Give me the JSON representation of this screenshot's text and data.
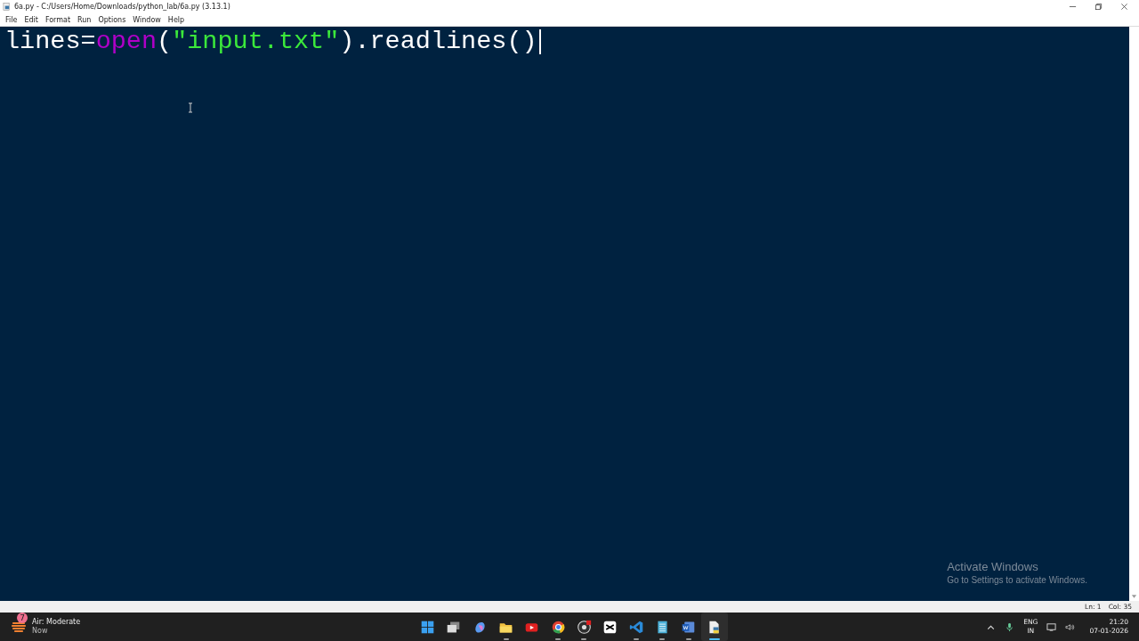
{
  "window": {
    "title": "6a.py - C:/Users/Home/Downloads/python_lab/6a.py (3.13.1)"
  },
  "menu": [
    {
      "label": "File"
    },
    {
      "label": "Edit"
    },
    {
      "label": "Format"
    },
    {
      "label": "Run"
    },
    {
      "label": "Options"
    },
    {
      "label": "Window"
    },
    {
      "label": "Help"
    }
  ],
  "editor": {
    "lines": [
      [
        {
          "text": "lines=",
          "kind": "plain"
        },
        {
          "text": "open",
          "kind": "builtin"
        },
        {
          "text": "(",
          "kind": "plain"
        },
        {
          "text": "\"input.txt\"",
          "kind": "string"
        },
        {
          "text": ").readlines()",
          "kind": "plain"
        }
      ]
    ]
  },
  "watermark": {
    "title": "Activate Windows",
    "subtitle": "Go to Settings to activate Windows."
  },
  "status_bar": {
    "line": "Ln: 1",
    "column": "Col: 35"
  },
  "taskbar": {
    "widget": {
      "badge": "7",
      "title": "Air: Moderate",
      "subtitle": "Now"
    },
    "apps": [
      {
        "kind": "start",
        "running": false,
        "selected": false
      },
      {
        "kind": "taskview",
        "running": false,
        "selected": false
      },
      {
        "kind": "copilot",
        "running": false,
        "selected": false
      },
      {
        "kind": "folder",
        "running": true,
        "selected": false
      },
      {
        "kind": "youtube",
        "running": false,
        "selected": false
      },
      {
        "kind": "chrome",
        "running": true,
        "selected": false
      },
      {
        "kind": "obs",
        "running": true,
        "selected": false
      },
      {
        "kind": "capcut",
        "running": false,
        "selected": false
      },
      {
        "kind": "vscode",
        "running": true,
        "selected": false
      },
      {
        "kind": "notepad",
        "running": true,
        "selected": false
      },
      {
        "kind": "word",
        "running": true,
        "selected": false
      },
      {
        "kind": "idle",
        "running": true,
        "selected": true
      }
    ],
    "language": "ENG",
    "region": "IN",
    "time": "21:20",
    "date": "07-01-2026"
  }
}
